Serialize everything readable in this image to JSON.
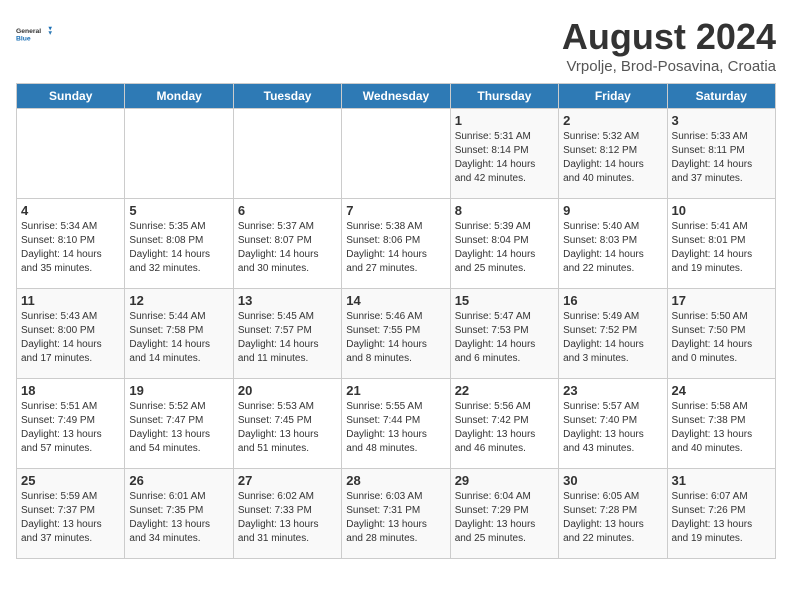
{
  "header": {
    "logo_general": "General",
    "logo_blue": "Blue",
    "title": "August 2024",
    "subtitle": "Vrpolje, Brod-Posavina, Croatia"
  },
  "weekdays": [
    "Sunday",
    "Monday",
    "Tuesday",
    "Wednesday",
    "Thursday",
    "Friday",
    "Saturday"
  ],
  "weeks": [
    [
      {
        "day": "",
        "info": ""
      },
      {
        "day": "",
        "info": ""
      },
      {
        "day": "",
        "info": ""
      },
      {
        "day": "",
        "info": ""
      },
      {
        "day": "1",
        "info": "Sunrise: 5:31 AM\nSunset: 8:14 PM\nDaylight: 14 hours\nand 42 minutes."
      },
      {
        "day": "2",
        "info": "Sunrise: 5:32 AM\nSunset: 8:12 PM\nDaylight: 14 hours\nand 40 minutes."
      },
      {
        "day": "3",
        "info": "Sunrise: 5:33 AM\nSunset: 8:11 PM\nDaylight: 14 hours\nand 37 minutes."
      }
    ],
    [
      {
        "day": "4",
        "info": "Sunrise: 5:34 AM\nSunset: 8:10 PM\nDaylight: 14 hours\nand 35 minutes."
      },
      {
        "day": "5",
        "info": "Sunrise: 5:35 AM\nSunset: 8:08 PM\nDaylight: 14 hours\nand 32 minutes."
      },
      {
        "day": "6",
        "info": "Sunrise: 5:37 AM\nSunset: 8:07 PM\nDaylight: 14 hours\nand 30 minutes."
      },
      {
        "day": "7",
        "info": "Sunrise: 5:38 AM\nSunset: 8:06 PM\nDaylight: 14 hours\nand 27 minutes."
      },
      {
        "day": "8",
        "info": "Sunrise: 5:39 AM\nSunset: 8:04 PM\nDaylight: 14 hours\nand 25 minutes."
      },
      {
        "day": "9",
        "info": "Sunrise: 5:40 AM\nSunset: 8:03 PM\nDaylight: 14 hours\nand 22 minutes."
      },
      {
        "day": "10",
        "info": "Sunrise: 5:41 AM\nSunset: 8:01 PM\nDaylight: 14 hours\nand 19 minutes."
      }
    ],
    [
      {
        "day": "11",
        "info": "Sunrise: 5:43 AM\nSunset: 8:00 PM\nDaylight: 14 hours\nand 17 minutes."
      },
      {
        "day": "12",
        "info": "Sunrise: 5:44 AM\nSunset: 7:58 PM\nDaylight: 14 hours\nand 14 minutes."
      },
      {
        "day": "13",
        "info": "Sunrise: 5:45 AM\nSunset: 7:57 PM\nDaylight: 14 hours\nand 11 minutes."
      },
      {
        "day": "14",
        "info": "Sunrise: 5:46 AM\nSunset: 7:55 PM\nDaylight: 14 hours\nand 8 minutes."
      },
      {
        "day": "15",
        "info": "Sunrise: 5:47 AM\nSunset: 7:53 PM\nDaylight: 14 hours\nand 6 minutes."
      },
      {
        "day": "16",
        "info": "Sunrise: 5:49 AM\nSunset: 7:52 PM\nDaylight: 14 hours\nand 3 minutes."
      },
      {
        "day": "17",
        "info": "Sunrise: 5:50 AM\nSunset: 7:50 PM\nDaylight: 14 hours\nand 0 minutes."
      }
    ],
    [
      {
        "day": "18",
        "info": "Sunrise: 5:51 AM\nSunset: 7:49 PM\nDaylight: 13 hours\nand 57 minutes."
      },
      {
        "day": "19",
        "info": "Sunrise: 5:52 AM\nSunset: 7:47 PM\nDaylight: 13 hours\nand 54 minutes."
      },
      {
        "day": "20",
        "info": "Sunrise: 5:53 AM\nSunset: 7:45 PM\nDaylight: 13 hours\nand 51 minutes."
      },
      {
        "day": "21",
        "info": "Sunrise: 5:55 AM\nSunset: 7:44 PM\nDaylight: 13 hours\nand 48 minutes."
      },
      {
        "day": "22",
        "info": "Sunrise: 5:56 AM\nSunset: 7:42 PM\nDaylight: 13 hours\nand 46 minutes."
      },
      {
        "day": "23",
        "info": "Sunrise: 5:57 AM\nSunset: 7:40 PM\nDaylight: 13 hours\nand 43 minutes."
      },
      {
        "day": "24",
        "info": "Sunrise: 5:58 AM\nSunset: 7:38 PM\nDaylight: 13 hours\nand 40 minutes."
      }
    ],
    [
      {
        "day": "25",
        "info": "Sunrise: 5:59 AM\nSunset: 7:37 PM\nDaylight: 13 hours\nand 37 minutes."
      },
      {
        "day": "26",
        "info": "Sunrise: 6:01 AM\nSunset: 7:35 PM\nDaylight: 13 hours\nand 34 minutes."
      },
      {
        "day": "27",
        "info": "Sunrise: 6:02 AM\nSunset: 7:33 PM\nDaylight: 13 hours\nand 31 minutes."
      },
      {
        "day": "28",
        "info": "Sunrise: 6:03 AM\nSunset: 7:31 PM\nDaylight: 13 hours\nand 28 minutes."
      },
      {
        "day": "29",
        "info": "Sunrise: 6:04 AM\nSunset: 7:29 PM\nDaylight: 13 hours\nand 25 minutes."
      },
      {
        "day": "30",
        "info": "Sunrise: 6:05 AM\nSunset: 7:28 PM\nDaylight: 13 hours\nand 22 minutes."
      },
      {
        "day": "31",
        "info": "Sunrise: 6:07 AM\nSunset: 7:26 PM\nDaylight: 13 hours\nand 19 minutes."
      }
    ]
  ]
}
